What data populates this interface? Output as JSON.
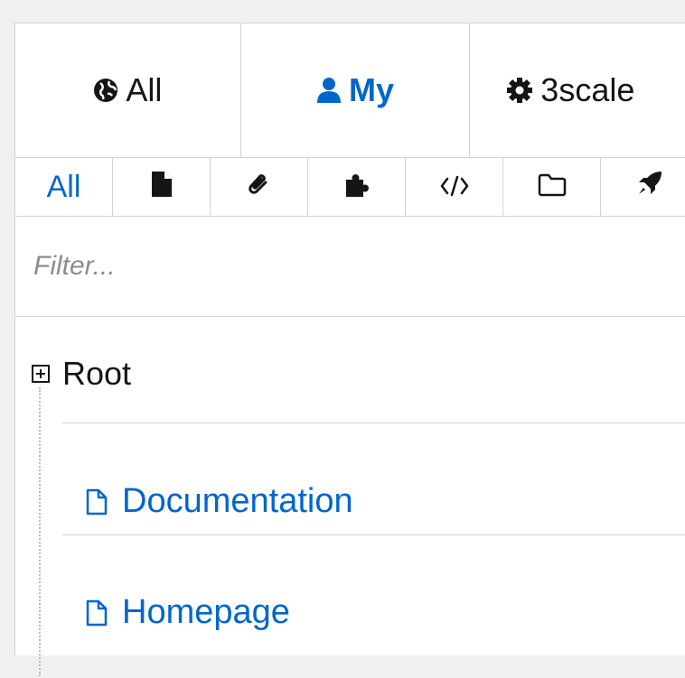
{
  "scope_tabs": [
    {
      "label": "All",
      "icon": "globe-icon",
      "active": false
    },
    {
      "label": "My",
      "icon": "user-icon",
      "active": true
    },
    {
      "label": "3scale",
      "icon": "gear-icon",
      "active": false
    }
  ],
  "type_tabs": [
    {
      "label": "All",
      "icon": null,
      "active": true
    },
    {
      "label": "",
      "icon": "file-solid-icon"
    },
    {
      "label": "",
      "icon": "paperclip-icon"
    },
    {
      "label": "",
      "icon": "puzzle-piece-icon"
    },
    {
      "label": "",
      "icon": "code-icon"
    },
    {
      "label": "",
      "icon": "folder-icon"
    },
    {
      "label": "",
      "icon": "rocket-icon"
    }
  ],
  "filter": {
    "placeholder": "Filter...",
    "value": ""
  },
  "tree": {
    "root_label": "Root",
    "items": [
      {
        "label": "Documentation",
        "icon": "page-icon"
      },
      {
        "label": "Homepage",
        "icon": "page-icon"
      }
    ]
  },
  "colors": {
    "accent": "#0066cc",
    "text": "#151515",
    "border": "#d2d2d2",
    "placeholder": "#8a8d90"
  }
}
